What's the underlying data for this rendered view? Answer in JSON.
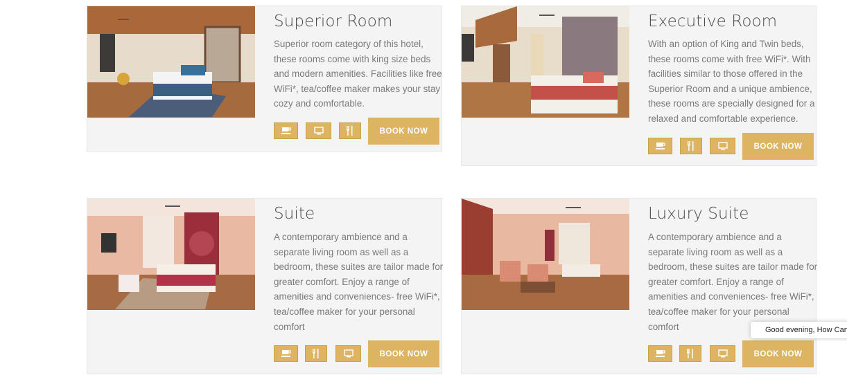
{
  "rooms": [
    {
      "title": "Superior Room",
      "description": "Superior room category of this hotel, these rooms come with king size beds and modern amenities. Facilities like free WiFi*, tea/coffee maker makes your stay cozy and comfortable.",
      "amenities": [
        "tea-cup-icon",
        "tv-icon",
        "dining-icon"
      ],
      "book_label": "BOOK NOW"
    },
    {
      "title": "Executive Room",
      "description": "With an option of King and Twin beds, these rooms come with free WiFi*. With facilities similar to those offered in the Superior Room and a unique ambience, these rooms are specially designed for a relaxed and comfortable experience.",
      "amenities": [
        "tea-cup-icon",
        "dining-icon",
        "tv-icon"
      ],
      "book_label": "BOOK NOW"
    },
    {
      "title": "Suite",
      "description": "A contemporary ambience and a separate living room as well as a bedroom, these suites are tailor made for greater comfort. Enjoy a range of amenities and conveniences- free WiFi*, tea/coffee maker for your personal comfort",
      "amenities": [
        "tea-cup-icon",
        "dining-icon",
        "tv-icon"
      ],
      "book_label": "BOOK NOW"
    },
    {
      "title": "Luxury Suite",
      "description": "A contemporary ambience and a separate living room as well as a bedroom, these suites are tailor made for greater comfort. Enjoy a range of amenities and conveniences- free WiFi*, tea/coffee maker for your personal comfort",
      "amenities": [
        "tea-cup-icon",
        "dining-icon",
        "tv-icon"
      ],
      "book_label": "BOOK NOW"
    }
  ],
  "chat": {
    "greeting": "Good evening, How Can"
  },
  "colors": {
    "accent": "#dcb462",
    "card_bg": "#f4f4f4",
    "title": "#4a4a4a",
    "text": "#7a7a7a"
  }
}
